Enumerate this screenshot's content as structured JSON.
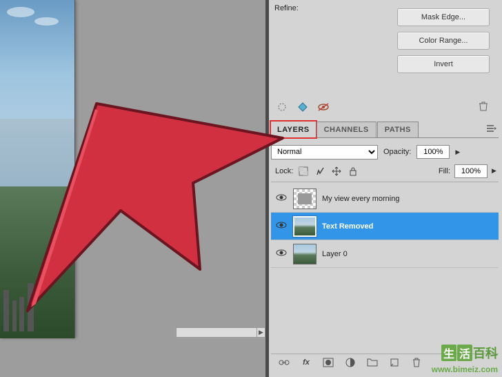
{
  "refine": {
    "label": "Refine:",
    "mask_edge_label": "Mask Edge...",
    "color_range_label": "Color Range...",
    "invert_label": "Invert"
  },
  "panel_tabs": {
    "layers": "LAYERS",
    "channels": "CHANNELS",
    "paths": "PATHS"
  },
  "blend": {
    "mode": "Normal",
    "opacity_label": "Opacity:",
    "opacity_value": "100%"
  },
  "lock": {
    "label": "Lock:",
    "fill_label": "Fill:",
    "fill_value": "100%"
  },
  "layers": [
    {
      "name": "My view every morning",
      "selected": false,
      "thumb_type": "checker"
    },
    {
      "name": "Text Removed",
      "selected": true,
      "thumb_type": "photo"
    },
    {
      "name": "Layer 0",
      "selected": false,
      "thumb_type": "photo"
    }
  ],
  "bottom_icons": {
    "link": "link-icon",
    "fx": "fx",
    "mask": "mask-icon",
    "adjust": "adjust-icon",
    "group": "group-icon",
    "new": "new-layer-icon",
    "trash": "trash-icon"
  },
  "watermark": {
    "text_boxes": [
      "生",
      "活"
    ],
    "text_plain": "百科",
    "url": "www.bimeiz.com"
  }
}
